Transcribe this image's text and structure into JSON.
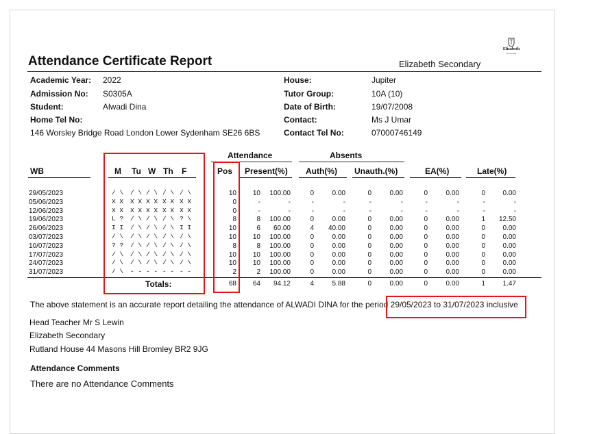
{
  "report": {
    "title": "Attendance Certificate Report",
    "school_name": "Elizabeth Secondary",
    "logo_text": "Elizabeth",
    "logo_subtext": "Secondary"
  },
  "student_info": {
    "left": [
      {
        "label": "Academic Year:",
        "value": "2022"
      },
      {
        "label": "Admission No:",
        "value": "S0305A"
      },
      {
        "label": "Student:",
        "value": "Alwadi Dina"
      },
      {
        "label": "Home Tel No:",
        "value": ""
      }
    ],
    "address": "146 Worsley Bridge Road London Lower Sydenham  SE26 6BS",
    "right": [
      {
        "label": "House:",
        "value": "Jupiter"
      },
      {
        "label": "Tutor Group:",
        "value": "10A (10)"
      },
      {
        "label": "Date of Birth:",
        "value": "19/07/2008"
      },
      {
        "label": "Contact:",
        "value": "Ms J Umar"
      },
      {
        "label": "Contact Tel No:",
        "value": "07000746149"
      }
    ]
  },
  "table": {
    "group_headers": {
      "attendance": "Attendance",
      "absents": "Absents"
    },
    "headers": {
      "wb": "WB",
      "m": "M",
      "tu": "Tu",
      "w": "W",
      "th": "Th",
      "f": "F",
      "pos": "Pos",
      "present": "Present(%)",
      "auth": "Auth(%)",
      "unauth": "Unauth.(%)",
      "ea": "EA(%)",
      "late": "Late(%)"
    },
    "rows": [
      {
        "wb": "29/05/2023",
        "days": [
          "/ \\",
          "/ \\",
          "/ \\",
          "/ \\",
          "/ \\"
        ],
        "pos": "10",
        "present": "10",
        "present_pct": "100.00",
        "auth": "0",
        "auth_pct": "0.00",
        "unauth": "0",
        "unauth_pct": "0.00",
        "ea": "0",
        "ea_pct": "0.00",
        "late": "0",
        "late_pct": "0.00"
      },
      {
        "wb": "05/06/2023",
        "days": [
          "X X",
          "X X",
          "X X",
          "X X",
          "X X"
        ],
        "pos": "0",
        "present": "-",
        "present_pct": "-",
        "auth": "-",
        "auth_pct": "-",
        "unauth": "-",
        "unauth_pct": "-",
        "ea": "-",
        "ea_pct": "-",
        "late": "-",
        "late_pct": "-"
      },
      {
        "wb": "12/06/2023",
        "days": [
          "X X",
          "X X",
          "X X",
          "X X",
          "X X"
        ],
        "pos": "0",
        "present": "-",
        "present_pct": "-",
        "auth": "-",
        "auth_pct": "-",
        "unauth": "-",
        "unauth_pct": "-",
        "ea": "-",
        "ea_pct": "-",
        "late": "-",
        "late_pct": "-"
      },
      {
        "wb": "19/06/2023",
        "days": [
          "L ?",
          "/ \\",
          "/ \\",
          "/ \\",
          "? \\"
        ],
        "pos": "8",
        "present": "8",
        "present_pct": "100.00",
        "auth": "0",
        "auth_pct": "0.00",
        "unauth": "0",
        "unauth_pct": "0.00",
        "ea": "0",
        "ea_pct": "0.00",
        "late": "1",
        "late_pct": "12.50"
      },
      {
        "wb": "26/06/2023",
        "days": [
          "I I",
          "/ \\",
          "/ \\",
          "/ \\",
          "I I"
        ],
        "pos": "10",
        "present": "6",
        "present_pct": "60.00",
        "auth": "4",
        "auth_pct": "40.00",
        "unauth": "0",
        "unauth_pct": "0.00",
        "ea": "0",
        "ea_pct": "0.00",
        "late": "0",
        "late_pct": "0.00"
      },
      {
        "wb": "03/07/2023",
        "days": [
          "/ \\",
          "/ \\",
          "/ \\",
          "/ \\",
          "/ \\"
        ],
        "pos": "10",
        "present": "10",
        "present_pct": "100.00",
        "auth": "0",
        "auth_pct": "0.00",
        "unauth": "0",
        "unauth_pct": "0.00",
        "ea": "0",
        "ea_pct": "0.00",
        "late": "0",
        "late_pct": "0.00"
      },
      {
        "wb": "10/07/2023",
        "days": [
          "? ?",
          "/ \\",
          "/ \\",
          "/ \\",
          "/ \\"
        ],
        "pos": "8",
        "present": "8",
        "present_pct": "100.00",
        "auth": "0",
        "auth_pct": "0.00",
        "unauth": "0",
        "unauth_pct": "0.00",
        "ea": "0",
        "ea_pct": "0.00",
        "late": "0",
        "late_pct": "0.00"
      },
      {
        "wb": "17/07/2023",
        "days": [
          "/ \\",
          "/ \\",
          "/ \\",
          "/ \\",
          "/ \\"
        ],
        "pos": "10",
        "present": "10",
        "present_pct": "100.00",
        "auth": "0",
        "auth_pct": "0.00",
        "unauth": "0",
        "unauth_pct": "0.00",
        "ea": "0",
        "ea_pct": "0.00",
        "late": "0",
        "late_pct": "0.00"
      },
      {
        "wb": "24/07/2023",
        "days": [
          "/ \\",
          "/ \\",
          "/ \\",
          "/ \\",
          "/ \\"
        ],
        "pos": "10",
        "present": "10",
        "present_pct": "100.00",
        "auth": "0",
        "auth_pct": "0.00",
        "unauth": "0",
        "unauth_pct": "0.00",
        "ea": "0",
        "ea_pct": "0.00",
        "late": "0",
        "late_pct": "0.00"
      },
      {
        "wb": "31/07/2023",
        "days": [
          "/ \\",
          "- -",
          "- -",
          "- -",
          "- -"
        ],
        "pos": "2",
        "present": "2",
        "present_pct": "100.00",
        "auth": "0",
        "auth_pct": "0.00",
        "unauth": "0",
        "unauth_pct": "0.00",
        "ea": "0",
        "ea_pct": "0.00",
        "late": "0",
        "late_pct": "0.00"
      }
    ],
    "totals": {
      "label": "Totals:",
      "pos": "68",
      "present": "64",
      "present_pct": "94.12",
      "auth": "4",
      "auth_pct": "5.88",
      "unauth": "0",
      "unauth_pct": "0.00",
      "ea": "0",
      "ea_pct": "0.00",
      "late": "1",
      "late_pct": "1.47"
    }
  },
  "statement": {
    "text": "The above statement is an accurate report detailing the attendance of ALWADI DINA for the period",
    "period": "29/05/2023 to 31/07/2023 inclusive"
  },
  "signoff": {
    "head_teacher": "Head Teacher Mr S Lewin",
    "school": "Elizabeth Secondary",
    "address": "Rutland House 44 Masons Hill  Bromley  BR2 9JG"
  },
  "comments": {
    "heading": "Attendance Comments",
    "text": "There are no Attendance Comments"
  },
  "annotation_color": "#e0161c"
}
